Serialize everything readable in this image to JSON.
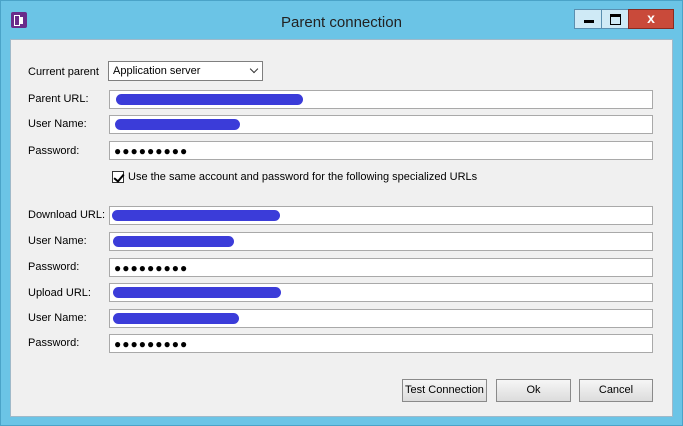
{
  "window": {
    "title": "Parent connection"
  },
  "form": {
    "current_parent_label": "Current parent",
    "current_parent_value": "Application server",
    "parent_url_label": "Parent URL:",
    "user_name_label": "User Name:",
    "password_label": "Password:",
    "password_mask": "●●●●●●●●●",
    "same_account_checkbox_label": "Use the same account and password for the following specialized URLs",
    "same_account_checked": true,
    "download_url_label": "Download URL:",
    "download_user_label": "User Name:",
    "download_password_label": "Password:",
    "download_password_mask": "●●●●●●●●●",
    "upload_url_label": "Upload URL:",
    "upload_user_label": "User Name:",
    "upload_password_label": "Password:",
    "upload_password_mask": "●●●●●●●●●"
  },
  "buttons": {
    "test_connection": "Test Connection",
    "ok": "Ok",
    "cancel": "Cancel"
  },
  "colors": {
    "titlebar": "#6bc4e6",
    "redaction": "#3b3cd9",
    "close_button": "#c94a3a"
  }
}
